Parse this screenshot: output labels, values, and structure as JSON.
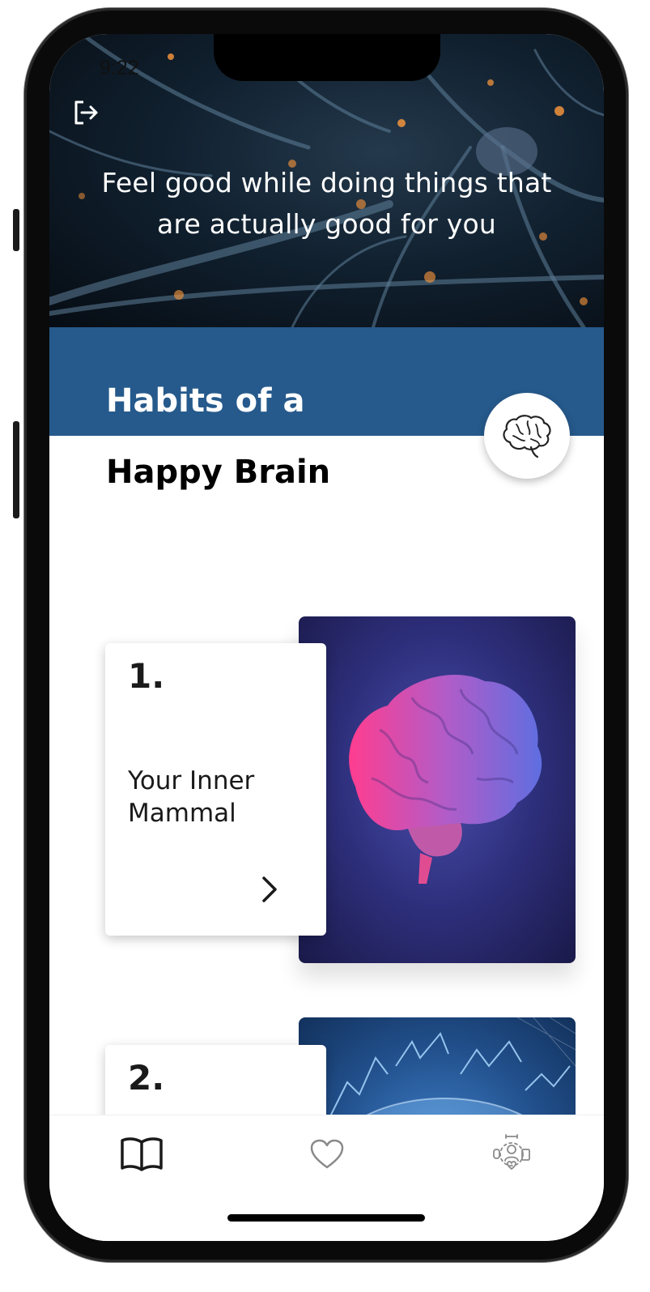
{
  "status_bar": {
    "time": "9:22"
  },
  "hero": {
    "tagline": "Feel good while doing things that are actually good for you"
  },
  "header": {
    "title_line1": "Habits of a",
    "title_line2": "Happy Brain"
  },
  "chapters": [
    {
      "number": "1.",
      "title": "Your Inner Mammal"
    },
    {
      "number": "2.",
      "title": ""
    }
  ],
  "icons": {
    "logout": "logout-icon",
    "brain": "brain-icon",
    "chevron": "chevron-right-icon",
    "tab_book": "book-icon",
    "tab_favorites": "heart-icon",
    "tab_community": "community-icon"
  },
  "colors": {
    "band": "#265a8c",
    "tab_active": "#1a1a1a",
    "tab_inactive": "#8a8a8a"
  }
}
